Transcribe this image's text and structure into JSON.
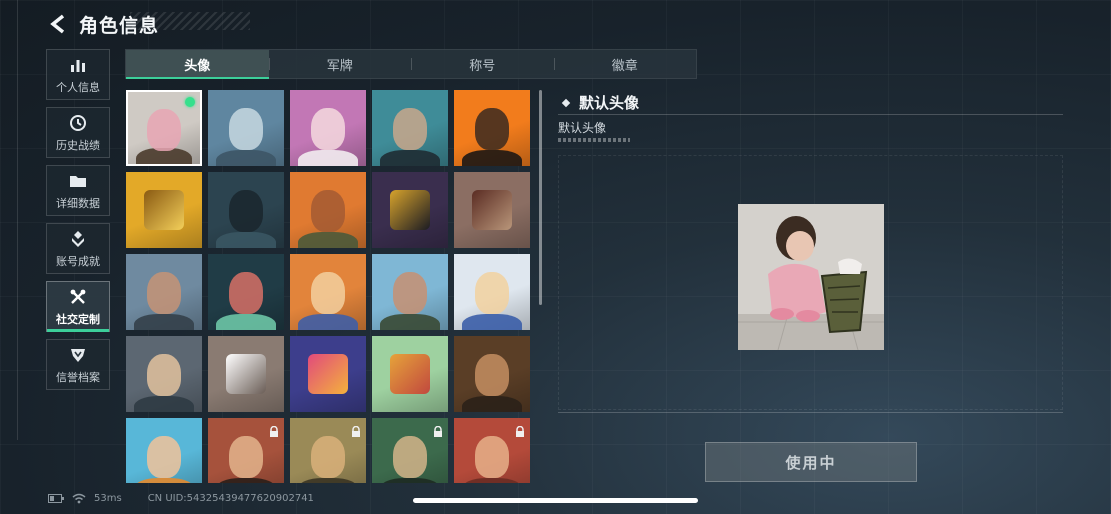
{
  "header": {
    "title": "角色信息"
  },
  "nav": [
    {
      "label": "个人信息",
      "icon": "bar-chart-icon"
    },
    {
      "label": "历史战绩",
      "icon": "clock-icon"
    },
    {
      "label": "详细数据",
      "icon": "folder-icon"
    },
    {
      "label": "账号成就",
      "icon": "achievement-icon"
    },
    {
      "label": "社交定制",
      "icon": "tools-icon",
      "active": true
    },
    {
      "label": "信誉档案",
      "icon": "shield-icon"
    }
  ],
  "tabs": [
    {
      "label": "头像",
      "active": true
    },
    {
      "label": "军牌"
    },
    {
      "label": "称号"
    },
    {
      "label": "徽章"
    }
  ],
  "avatars": [
    {
      "kind": "photo",
      "selected": true,
      "equipped": true,
      "bg": "#cfcac4",
      "c1": "#e7a6b4",
      "c2": "#4a3b2c"
    },
    {
      "kind": "portrait",
      "bg": "#5f86a0",
      "c1": "#c7d8e0",
      "c2": "#3d5566"
    },
    {
      "kind": "portrait",
      "bg": "#c277b5",
      "c1": "#f4d9de",
      "c2": "#f2ecf0"
    },
    {
      "kind": "portrait",
      "bg": "#3f8c98",
      "c1": "#c9a78b",
      "c2": "#1f2c33"
    },
    {
      "kind": "portrait",
      "bg": "#f27c1c",
      "c1": "#3b2a20",
      "c2": "#1d1714"
    },
    {
      "kind": "emblem",
      "bg": "#e3a928",
      "c1": "#8a5a12",
      "c2": "#f3cf5a"
    },
    {
      "kind": "portrait",
      "bg": "#2c4450",
      "c1": "#1a262d",
      "c2": "#3a5663"
    },
    {
      "kind": "portrait",
      "bg": "#e07a31",
      "c1": "#a35a33",
      "c2": "#4b5a3a"
    },
    {
      "kind": "emblem",
      "bg": "#3a2e4e",
      "c1": "#d7a32c",
      "c2": "#1b1b23"
    },
    {
      "kind": "emblem",
      "bg": "#8b6e63",
      "c1": "#5a2c23",
      "c2": "#b9967a"
    },
    {
      "kind": "portrait",
      "bg": "#6f8aa0",
      "c1": "#c69375",
      "c2": "#34404a"
    },
    {
      "kind": "portrait",
      "bg": "#203c46",
      "c1": "#d77066",
      "c2": "#6dc5a6"
    },
    {
      "kind": "portrait",
      "bg": "#e2843b",
      "c1": "#f2cf9f",
      "c2": "#3f5ea6"
    },
    {
      "kind": "portrait",
      "bg": "#7fb7d5",
      "c1": "#c79072",
      "c2": "#3a4a35"
    },
    {
      "kind": "portrait",
      "bg": "#dfe7ef",
      "c1": "#f2d19f",
      "c2": "#3b5ea8"
    },
    {
      "kind": "portrait",
      "bg": "#5c6772",
      "c1": "#e2c29e",
      "c2": "#2f3b44"
    },
    {
      "kind": "emblem",
      "bg": "#8a7b72",
      "c1": "#ffffff",
      "c2": "#6a5d56"
    },
    {
      "kind": "emblem",
      "bg": "#3d3e8c",
      "c1": "#e14a7c",
      "c2": "#f4b23c"
    },
    {
      "kind": "emblem",
      "bg": "#9ed1a0",
      "c1": "#e6a33a",
      "c2": "#c1483e"
    },
    {
      "kind": "portrait",
      "bg": "#5a3e26",
      "c1": "#c48e62",
      "c2": "#2b2118"
    },
    {
      "kind": "portrait",
      "bg": "#58b7d8",
      "c1": "#f1c39a",
      "c2": "#e38a2d"
    },
    {
      "kind": "portrait",
      "bg": "#a6523c",
      "c1": "#e3b48c",
      "c2": "#2a1e18",
      "locked": true
    },
    {
      "kind": "portrait",
      "bg": "#9a8a57",
      "c1": "#d9b07a",
      "c2": "#3a3424",
      "locked": true
    },
    {
      "kind": "portrait",
      "bg": "#3c6a4c",
      "c1": "#d3b48a",
      "c2": "#1d2a22",
      "locked": true
    },
    {
      "kind": "portrait",
      "bg": "#b44a3a",
      "c1": "#e6b08a",
      "c2": "#6a2c24",
      "locked": true
    }
  ],
  "detail": {
    "title": "默认头像",
    "subtitle": "默认头像",
    "button_label": "使用中"
  },
  "status": {
    "latency": "53ms",
    "uid": "CN UID:54325439477620902741"
  },
  "colors": {
    "accent": "#3ccf9a",
    "equipped": "#36e08c"
  }
}
